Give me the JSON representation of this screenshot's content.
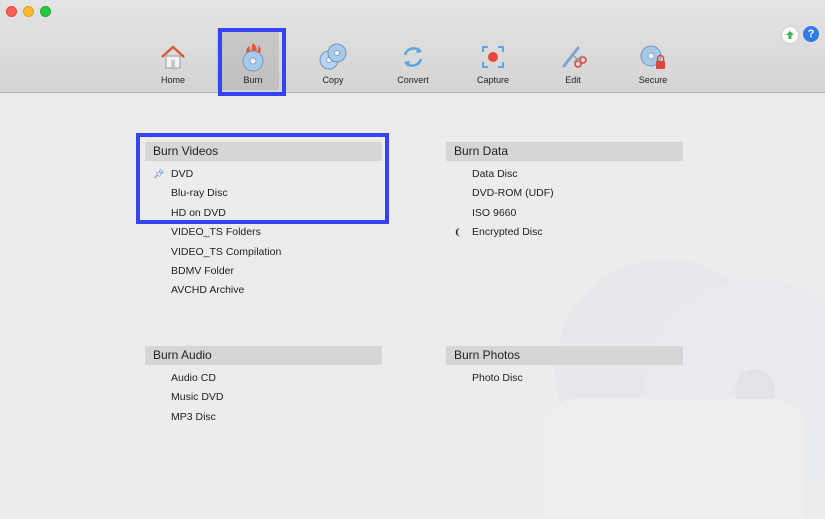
{
  "toolbar": {
    "tools": [
      {
        "label": "Home",
        "icon": "home-icon"
      },
      {
        "label": "Burn",
        "icon": "burn-disc-icon",
        "active": true
      },
      {
        "label": "Copy",
        "icon": "copy-disc-icon"
      },
      {
        "label": "Convert",
        "icon": "convert-icon"
      },
      {
        "label": "Capture",
        "icon": "capture-icon"
      },
      {
        "label": "Edit",
        "icon": "edit-icon"
      },
      {
        "label": "Secure",
        "icon": "secure-disc-icon"
      }
    ],
    "update_icon": "up-arrow-icon",
    "help_label": "?"
  },
  "sections": {
    "burn_videos": {
      "title": "Burn Videos",
      "items": [
        "DVD",
        "Blu-ray Disc",
        "HD on DVD",
        "VIDEO_TS Folders",
        "VIDEO_TS Compilation",
        "BDMV Folder",
        "AVCHD Archive"
      ]
    },
    "burn_data": {
      "title": "Burn Data",
      "items": [
        "Data Disc",
        "DVD-ROM (UDF)",
        "ISO 9660",
        "Encrypted Disc"
      ]
    },
    "burn_audio": {
      "title": "Burn Audio",
      "items": [
        "Audio CD",
        "Music DVD",
        "MP3 Disc"
      ]
    },
    "burn_photos": {
      "title": "Burn Photos",
      "items": [
        "Photo Disc"
      ]
    }
  },
  "colors": {
    "highlight": "#3543f0",
    "accent": "#2f7ae5"
  }
}
